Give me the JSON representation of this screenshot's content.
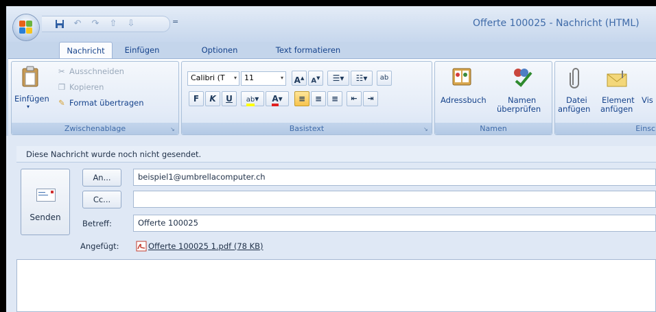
{
  "window": {
    "title": "Offerte 100025 - Nachricht (HTML)"
  },
  "qat": {
    "more": "="
  },
  "tabs": [
    {
      "label": "Nachricht"
    },
    {
      "label": "Einfügen"
    },
    {
      "label": "Optionen"
    },
    {
      "label": "Text formatieren"
    }
  ],
  "ribbon": {
    "clipboard": {
      "label": "Zwischenablage",
      "paste": "Einfügen",
      "cut": "Ausschneiden",
      "copy": "Kopieren",
      "format_painter": "Format übertragen"
    },
    "basic_text": {
      "label": "Basistext",
      "font": "Calibri (T",
      "font_size": "11",
      "bold": "F",
      "italic": "K",
      "underline": "U"
    },
    "names": {
      "label": "Namen",
      "address_book": "Adressbuch",
      "check_names_1": "Namen",
      "check_names_2": "überprüfen"
    },
    "include": {
      "label": "Einsc",
      "attach_file_1": "Datei",
      "attach_file_2": "anfügen",
      "attach_item_1": "Element",
      "attach_item_2": "anfügen",
      "vis": "Vis"
    }
  },
  "compose": {
    "info": "Diese Nachricht wurde noch nicht gesendet.",
    "send": "Senden",
    "to_button": "An...",
    "cc_button": "Cc...",
    "to_value": "beispiel1@umbrellacomputer.ch",
    "cc_value": "",
    "subject_label": "Betreff:",
    "subject_value": "Offerte 100025",
    "attached_label": "Angefügt:",
    "attachment": "Offerte 100025 1.pdf (78 KB)"
  }
}
